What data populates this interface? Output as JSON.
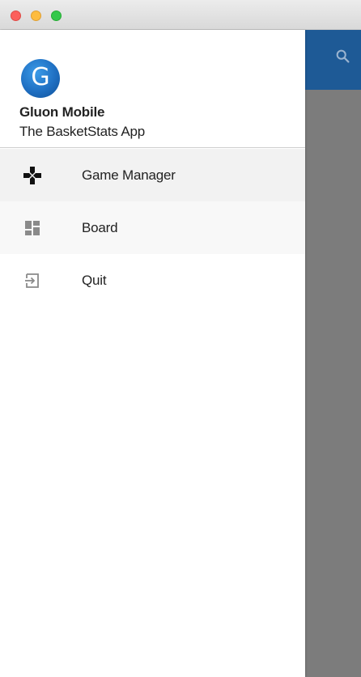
{
  "window": {
    "controls": [
      "close",
      "minimize",
      "zoom"
    ]
  },
  "app_bar": {
    "color": "#1e5a96",
    "search_icon": "search-icon"
  },
  "drawer": {
    "header": {
      "logo_letter": "G",
      "title": "Gluon Mobile",
      "subtitle": "The BasketStats App"
    },
    "items": [
      {
        "label": "Game Manager",
        "icon": "gamepad-icon",
        "selected": true
      },
      {
        "label": "Board",
        "icon": "dashboard-icon",
        "selected": false
      },
      {
        "label": "Quit",
        "icon": "exit-icon",
        "selected": false
      }
    ]
  }
}
